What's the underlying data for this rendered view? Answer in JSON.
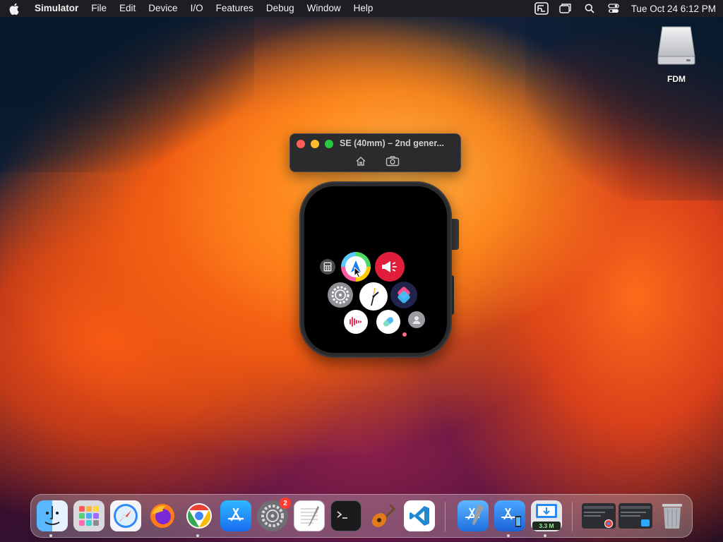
{
  "menubar": {
    "app_name": "Simulator",
    "items": [
      "File",
      "Edit",
      "Device",
      "I/O",
      "Features",
      "Debug",
      "Window",
      "Help"
    ],
    "clock": "Tue Oct 24  6:12 PM"
  },
  "desktop": {
    "disk_label": "FDM"
  },
  "simulator": {
    "title": "SE (40mm) – 2nd gener..."
  },
  "watch": {
    "apps": [
      "calculator",
      "maps",
      "noise",
      "settings",
      "clock",
      "shortcuts",
      "voice-memos",
      "medications",
      "contacts"
    ]
  },
  "dock": {
    "items": [
      "Finder",
      "Launchpad",
      "Safari",
      "Firefox",
      "Google Chrome",
      "App Store",
      "System Settings",
      "TextEdit",
      "Terminal",
      "Instruments",
      "Visual Studio Code",
      "Xcode",
      "Simulator",
      "Download Manager",
      "Chrome Window",
      "Preview Window",
      "Trash"
    ],
    "settings_badge": "2",
    "download_label": "3.3 M"
  },
  "colors": {
    "menubar_bg": "#1e1e23",
    "close": "#ff5f57",
    "minimize": "#febc2e",
    "zoom": "#28c840"
  }
}
